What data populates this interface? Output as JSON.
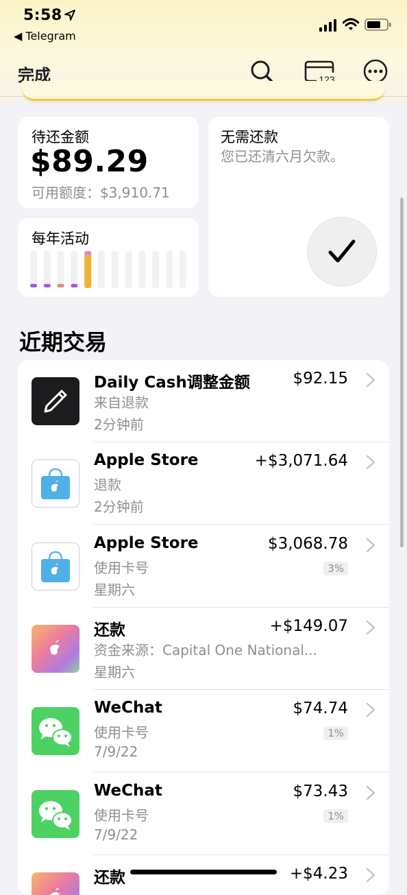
{
  "status": {
    "time": "5:58",
    "back_app": "◀ Telegram"
  },
  "nav": {
    "done": "完成",
    "card_number_label": "123"
  },
  "balance": {
    "title": "待还金额",
    "amount": "$89.29",
    "available": "可用额度：$3,910.71"
  },
  "activity": {
    "title": "每年活动",
    "bars": [
      {
        "dot": "#af52de"
      },
      {
        "dot": "#af52de"
      },
      {
        "dot": "#d98a87"
      },
      {
        "dot": "#af52de"
      },
      {
        "dot": "#f2b035",
        "fill": 1.0,
        "highlight": true
      },
      {},
      {},
      {},
      {},
      {},
      {},
      {}
    ]
  },
  "payment": {
    "title": "无需还款",
    "subtitle": "您已还清六月欠款。"
  },
  "section_title": "近期交易",
  "transactions": [
    {
      "name": "Daily Cash调整金额",
      "desc": "来自退款",
      "time": "2分钟前",
      "amount": "$92.15",
      "badge": "",
      "icon": "pencil-icon"
    },
    {
      "name": "Apple Store",
      "desc": "退款",
      "time": "2分钟前",
      "amount": "+$3,071.64",
      "badge": "",
      "icon": "apple-store-bag-icon"
    },
    {
      "name": "Apple Store",
      "desc": "使用卡号",
      "time": "星期六",
      "amount": "$3,068.78",
      "badge": "3%",
      "icon": "apple-store-bag-icon"
    },
    {
      "name": "还款",
      "desc": "资金来源：Capital One National...",
      "time": "星期六",
      "amount": "+$149.07",
      "badge": "",
      "icon": "apple-card-payment-icon"
    },
    {
      "name": "WeChat",
      "desc": "使用卡号",
      "time": "7/9/22",
      "amount": "$74.74",
      "badge": "1%",
      "icon": "wechat-icon"
    },
    {
      "name": "WeChat",
      "desc": "使用卡号",
      "time": "7/9/22",
      "amount": "$73.43",
      "badge": "1%",
      "icon": "wechat-icon"
    },
    {
      "name": "还款",
      "desc": "",
      "time": "",
      "amount": "+$4.23",
      "badge": "",
      "icon": "apple-card-payment-icon"
    }
  ],
  "colors": {
    "accent_yellow": "#f2b035",
    "wechat_green": "#4cd263",
    "secondary_text": "#8e8e93"
  }
}
